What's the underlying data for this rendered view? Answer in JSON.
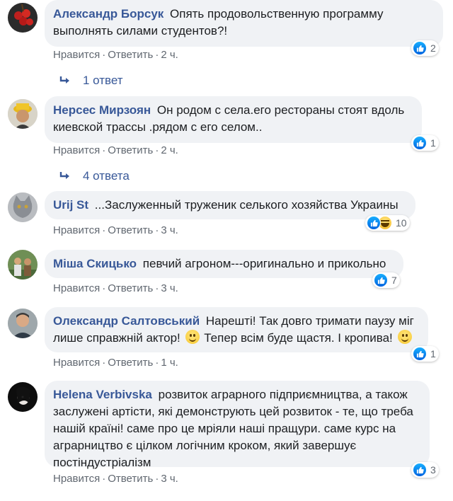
{
  "labels": {
    "like": "Нравится",
    "reply": "Ответить",
    "sep": "·"
  },
  "colors": {
    "author": "#385898",
    "bubble": "#f0f2f5",
    "meta": "#606770",
    "like_blue": "#1877f2"
  },
  "comments": [
    {
      "author": "Александр Борсук",
      "text": "Опять продовольственную программу выполнять силами студентов?!",
      "time": "2 ч.",
      "reactions": {
        "icons": [
          "like-icon"
        ],
        "count": "2"
      },
      "replies": "1 ответ"
    },
    {
      "author": "Нерсес Мирзоян",
      "text": "Он родом с села.его рестораны стоят вдоль киевской трассы .рядом с его селом..",
      "time": "2 ч.",
      "reactions": {
        "icons": [
          "like-icon"
        ],
        "count": "1"
      },
      "replies": "4 ответа"
    },
    {
      "author": "Urij St",
      "text": "...Заслуженный труженик селького хозяйства Украины",
      "time": "3 ч.",
      "reactions": {
        "icons": [
          "like-icon",
          "haha-icon"
        ],
        "count": "10"
      }
    },
    {
      "author": "Міша Скицько",
      "text": "певчий агроном---оригинально и прикольно",
      "time": "3 ч.",
      "reactions": {
        "icons": [
          "like-icon"
        ],
        "count": "7"
      }
    },
    {
      "author": "Олександр Салтовський",
      "text_parts": [
        "Нарешті! Так довго тримати паузу міг лише справжній актор!",
        "Тепер всім буде щастя. І кропива!"
      ],
      "time": "1 ч.",
      "reactions": {
        "icons": [
          "like-icon"
        ],
        "count": "1"
      }
    },
    {
      "author": "Helena Verbivska",
      "text": "розвиток аграрного підприємництва, а також заслужені артісти, які демонструють цей розвиток - те, що треба нашій країні! саме про це мріяли наші пращури. саме курс на аграрництво є цілком логічним кроком, який завершує постіндустріалізм",
      "time": "3 ч.",
      "reactions": {
        "icons": [
          "like-icon"
        ],
        "count": "3"
      }
    }
  ]
}
